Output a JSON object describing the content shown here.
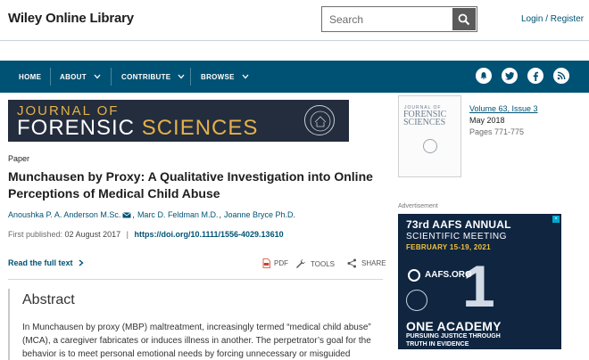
{
  "header": {
    "brand": "Wiley Online Library",
    "search": {
      "placeholder": "Search"
    },
    "login_label": "Login / Register"
  },
  "nav": {
    "items": [
      {
        "label": "HOME"
      },
      {
        "label": "ABOUT"
      },
      {
        "label": "CONTRIBUTE"
      },
      {
        "label": "BROWSE"
      }
    ],
    "social_icons": [
      "bell-icon",
      "twitter-icon",
      "facebook-icon",
      "rss-icon"
    ]
  },
  "banner": {
    "line1": "JOURNAL OF",
    "line2_a": "FORENSIC",
    "line2_b": "SCIENCES"
  },
  "article": {
    "type": "Paper",
    "title": "Munchausen by Proxy: A Qualitative Investigation into Online Perceptions of Medical Child Abuse",
    "authors": [
      "Anoushka P. A. Anderson M.Sc.",
      "Marc D. Feldman M.D.",
      "Joanne Bryce Ph.D."
    ],
    "first_published_label": "First published:",
    "first_published_date": "02 August 2017",
    "doi": "https://doi.org/10.1111/1556-4029.13610",
    "read_full_text": "Read the full text",
    "tools": {
      "pdf": "PDF",
      "tools": "TOOLS",
      "share": "SHARE"
    }
  },
  "abstract": {
    "heading": "Abstract",
    "text": "In Munchausen by proxy (MBP) maltreatment, increasingly termed “medical child abuse” (MCA), a caregiver fabricates or induces illness in another. The perpetrator’s goal for the behavior is to meet personal emotional needs by forcing unnecessary or misguided"
  },
  "issue": {
    "cover_line1": "JOURNAL OF",
    "cover_line2": "FORENSIC",
    "cover_line3": "SCIENCES",
    "volume": "Volume 63, Issue 3",
    "date": "May 2018",
    "pages": "Pages 771-775"
  },
  "ad": {
    "label": "Advertisement",
    "line1": "73rd AAFS ANNUAL",
    "line2": "SCIENTIFIC MEETING",
    "line3": "FEBRUARY 15-19, 2021",
    "site": "AAFS.ORG",
    "big": "1",
    "line5": "ONE ACADEMY",
    "line6": "PURSUING JUSTICE THROUGH TRUTH IN EVIDENCE"
  },
  "colors": {
    "brand_blue": "#005274",
    "banner_bg": "#232d3d",
    "banner_gold": "#e6b14a",
    "ad_bg": "#0f2540",
    "ad_yellow": "#f3c23b"
  }
}
